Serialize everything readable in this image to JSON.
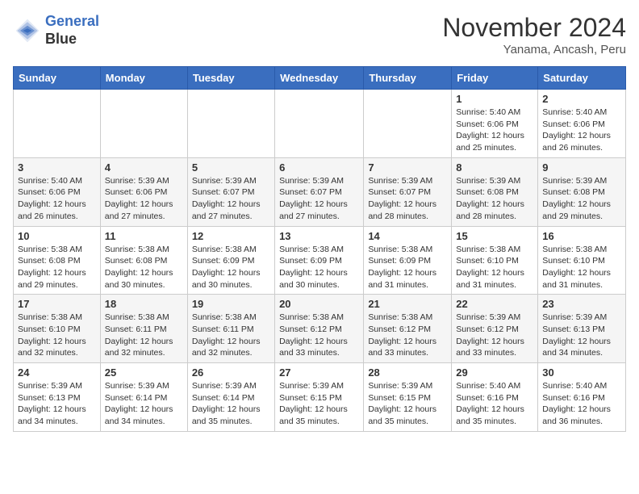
{
  "header": {
    "logo_line1": "General",
    "logo_line2": "Blue",
    "month": "November 2024",
    "location": "Yanama, Ancash, Peru"
  },
  "days_of_week": [
    "Sunday",
    "Monday",
    "Tuesday",
    "Wednesday",
    "Thursday",
    "Friday",
    "Saturday"
  ],
  "weeks": [
    [
      {
        "day": "",
        "info": ""
      },
      {
        "day": "",
        "info": ""
      },
      {
        "day": "",
        "info": ""
      },
      {
        "day": "",
        "info": ""
      },
      {
        "day": "",
        "info": ""
      },
      {
        "day": "1",
        "info": "Sunrise: 5:40 AM\nSunset: 6:06 PM\nDaylight: 12 hours and 25 minutes."
      },
      {
        "day": "2",
        "info": "Sunrise: 5:40 AM\nSunset: 6:06 PM\nDaylight: 12 hours and 26 minutes."
      }
    ],
    [
      {
        "day": "3",
        "info": "Sunrise: 5:40 AM\nSunset: 6:06 PM\nDaylight: 12 hours and 26 minutes."
      },
      {
        "day": "4",
        "info": "Sunrise: 5:39 AM\nSunset: 6:06 PM\nDaylight: 12 hours and 27 minutes."
      },
      {
        "day": "5",
        "info": "Sunrise: 5:39 AM\nSunset: 6:07 PM\nDaylight: 12 hours and 27 minutes."
      },
      {
        "day": "6",
        "info": "Sunrise: 5:39 AM\nSunset: 6:07 PM\nDaylight: 12 hours and 27 minutes."
      },
      {
        "day": "7",
        "info": "Sunrise: 5:39 AM\nSunset: 6:07 PM\nDaylight: 12 hours and 28 minutes."
      },
      {
        "day": "8",
        "info": "Sunrise: 5:39 AM\nSunset: 6:08 PM\nDaylight: 12 hours and 28 minutes."
      },
      {
        "day": "9",
        "info": "Sunrise: 5:39 AM\nSunset: 6:08 PM\nDaylight: 12 hours and 29 minutes."
      }
    ],
    [
      {
        "day": "10",
        "info": "Sunrise: 5:38 AM\nSunset: 6:08 PM\nDaylight: 12 hours and 29 minutes."
      },
      {
        "day": "11",
        "info": "Sunrise: 5:38 AM\nSunset: 6:08 PM\nDaylight: 12 hours and 30 minutes."
      },
      {
        "day": "12",
        "info": "Sunrise: 5:38 AM\nSunset: 6:09 PM\nDaylight: 12 hours and 30 minutes."
      },
      {
        "day": "13",
        "info": "Sunrise: 5:38 AM\nSunset: 6:09 PM\nDaylight: 12 hours and 30 minutes."
      },
      {
        "day": "14",
        "info": "Sunrise: 5:38 AM\nSunset: 6:09 PM\nDaylight: 12 hours and 31 minutes."
      },
      {
        "day": "15",
        "info": "Sunrise: 5:38 AM\nSunset: 6:10 PM\nDaylight: 12 hours and 31 minutes."
      },
      {
        "day": "16",
        "info": "Sunrise: 5:38 AM\nSunset: 6:10 PM\nDaylight: 12 hours and 31 minutes."
      }
    ],
    [
      {
        "day": "17",
        "info": "Sunrise: 5:38 AM\nSunset: 6:10 PM\nDaylight: 12 hours and 32 minutes."
      },
      {
        "day": "18",
        "info": "Sunrise: 5:38 AM\nSunset: 6:11 PM\nDaylight: 12 hours and 32 minutes."
      },
      {
        "day": "19",
        "info": "Sunrise: 5:38 AM\nSunset: 6:11 PM\nDaylight: 12 hours and 32 minutes."
      },
      {
        "day": "20",
        "info": "Sunrise: 5:38 AM\nSunset: 6:12 PM\nDaylight: 12 hours and 33 minutes."
      },
      {
        "day": "21",
        "info": "Sunrise: 5:38 AM\nSunset: 6:12 PM\nDaylight: 12 hours and 33 minutes."
      },
      {
        "day": "22",
        "info": "Sunrise: 5:39 AM\nSunset: 6:12 PM\nDaylight: 12 hours and 33 minutes."
      },
      {
        "day": "23",
        "info": "Sunrise: 5:39 AM\nSunset: 6:13 PM\nDaylight: 12 hours and 34 minutes."
      }
    ],
    [
      {
        "day": "24",
        "info": "Sunrise: 5:39 AM\nSunset: 6:13 PM\nDaylight: 12 hours and 34 minutes."
      },
      {
        "day": "25",
        "info": "Sunrise: 5:39 AM\nSunset: 6:14 PM\nDaylight: 12 hours and 34 minutes."
      },
      {
        "day": "26",
        "info": "Sunrise: 5:39 AM\nSunset: 6:14 PM\nDaylight: 12 hours and 35 minutes."
      },
      {
        "day": "27",
        "info": "Sunrise: 5:39 AM\nSunset: 6:15 PM\nDaylight: 12 hours and 35 minutes."
      },
      {
        "day": "28",
        "info": "Sunrise: 5:39 AM\nSunset: 6:15 PM\nDaylight: 12 hours and 35 minutes."
      },
      {
        "day": "29",
        "info": "Sunrise: 5:40 AM\nSunset: 6:16 PM\nDaylight: 12 hours and 35 minutes."
      },
      {
        "day": "30",
        "info": "Sunrise: 5:40 AM\nSunset: 6:16 PM\nDaylight: 12 hours and 36 minutes."
      }
    ]
  ]
}
